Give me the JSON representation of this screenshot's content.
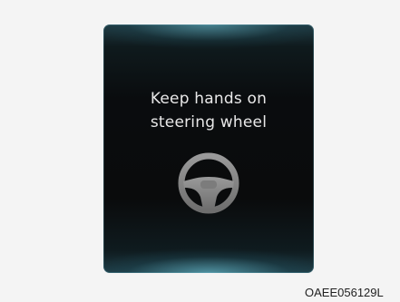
{
  "display": {
    "message_line1": "Keep hands on",
    "message_line2": "steering wheel",
    "icon": "steering-wheel-icon",
    "accent_color": "#78d7eb",
    "text_color": "#e8e8e8",
    "icon_color": "#8a8a8a"
  },
  "figure": {
    "code": "OAEE056129L"
  }
}
